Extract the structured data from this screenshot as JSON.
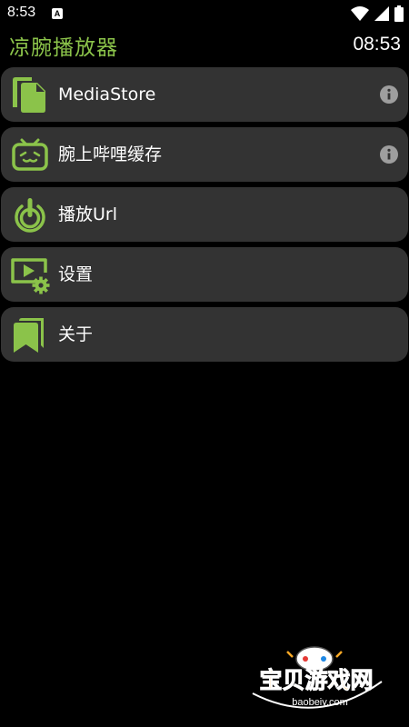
{
  "status_bar": {
    "time": "8:53",
    "notification_icon": "A",
    "icons": [
      "wifi-icon",
      "signal-icon",
      "battery-icon"
    ]
  },
  "header": {
    "title": "凉腕播放器",
    "clock": "08:53"
  },
  "menu": {
    "items": [
      {
        "label": "MediaStore",
        "icon": "document-copy-icon",
        "has_info": true
      },
      {
        "label": "腕上哔哩缓存",
        "icon": "bilibili-tv-icon",
        "has_info": true
      },
      {
        "label": "播放Url",
        "icon": "play-url-icon",
        "has_info": false
      },
      {
        "label": "设置",
        "icon": "video-settings-icon",
        "has_info": false
      },
      {
        "label": "关于",
        "icon": "bookmarks-icon",
        "has_info": false
      }
    ]
  },
  "watermark": {
    "title": "宝贝游戏网",
    "url": "baobeiy.com"
  },
  "colors": {
    "accent": "#8bc34a",
    "card": "#333333",
    "background": "#000000"
  }
}
